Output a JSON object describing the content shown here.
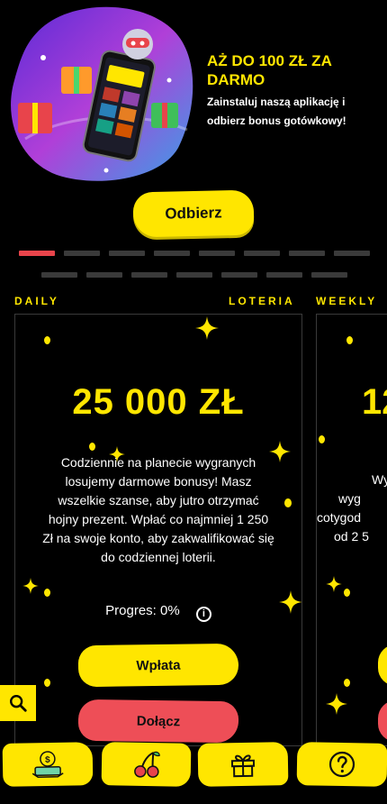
{
  "promo": {
    "title": "AŻ DO 100 ZŁ ZA DARMO",
    "text": "Zainstaluj naszą aplikację i odbierz bonus gotówkowy!",
    "cta_label": "Odbierz",
    "slide_count": 15,
    "active_slide": 1
  },
  "lottery_tabs": {
    "daily": "DAILY",
    "loteria": "LOTERIA",
    "weekly": "WEEKLY"
  },
  "daily_card": {
    "prize": "25 000 ZŁ",
    "description": "Codziennie na planecie wygranych losujemy darmowe bonusy! Masz wszelkie szanse, aby jutro otrzymać hojny prezent. Wpłać co najmniej 1 250 Zł na swoje konto, aby zakwalifikować się do codziennej loterii.",
    "progress_label": "Progres: 0%",
    "progress_value": 0,
    "deposit_label": "Wpłata",
    "join_label": "Dołącz"
  },
  "weekly_card": {
    "prize_partial": "12",
    "desc_line1": "Wy",
    "desc_line2": "wyg",
    "desc_line3": "cotygod",
    "desc_line4": "od 2 5"
  },
  "colors": {
    "accent": "#ffe600",
    "join": "#ee4e57",
    "dot_active": "#e8444b",
    "dot_inactive": "#3a3a3a"
  },
  "bottom_nav": {
    "items": [
      "deposit-money-icon",
      "cherries-icon",
      "gift-icon",
      "help-icon"
    ]
  }
}
